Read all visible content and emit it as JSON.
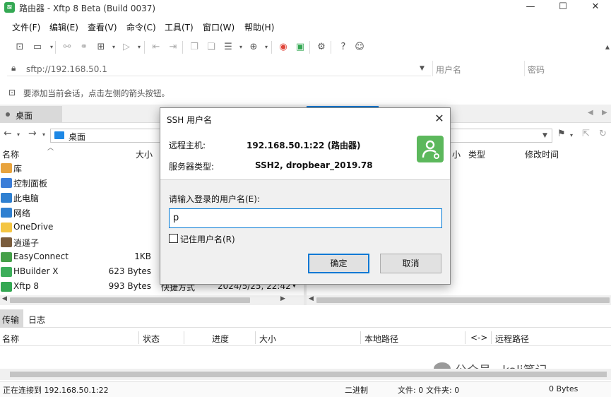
{
  "window": {
    "app_icon_glyph": "≋",
    "title": "路由器 - Xftp 8 Beta (Build 0037)",
    "minimize_glyph": "—",
    "maximize_glyph": "☐",
    "close_glyph": "✕"
  },
  "menu": {
    "items": [
      "文件(F)",
      "编辑(E)",
      "查看(V)",
      "命令(C)",
      "工具(T)",
      "窗口(W)",
      "帮助(H)"
    ]
  },
  "address": {
    "url": "sftp://192.168.50.1",
    "username_placeholder": "用户名",
    "password_placeholder": "密码"
  },
  "hint": {
    "text": "要添加当前会话，点击左侧的箭头按钮。"
  },
  "local_tab": {
    "label": "桌面"
  },
  "local_path": {
    "value": "桌面"
  },
  "local_columns": {
    "name": "名称",
    "size": "大小"
  },
  "remote_columns": {
    "size_partial": "小",
    "type": "类型",
    "modified": "修改时间"
  },
  "local_files": [
    {
      "name": "库",
      "size": "",
      "icon": "library-icon",
      "color": "#e8a33d"
    },
    {
      "name": "控制面板",
      "size": "",
      "icon": "control-panel-icon",
      "color": "#3b7dd8"
    },
    {
      "name": "此电脑",
      "size": "",
      "icon": "computer-icon",
      "color": "#2f80d1"
    },
    {
      "name": "网络",
      "size": "",
      "icon": "network-icon",
      "color": "#2f80d1"
    },
    {
      "name": "OneDrive",
      "size": "",
      "icon": "folder-icon",
      "color": "#f4c542"
    },
    {
      "name": "逍遥子",
      "size": "",
      "icon": "user-icon",
      "color": "#7a5c3c"
    },
    {
      "name": "EasyConnect",
      "size": "1KB",
      "icon": "easyconnect-icon",
      "color": "#45a049"
    },
    {
      "name": "HBuilder X",
      "size": "623 Bytes",
      "icon": "hbuilder-icon",
      "color": "#3cae5a"
    },
    {
      "name": "Xftp 8",
      "size": "993 Bytes",
      "icon": "xftp-icon",
      "color": "#34a853",
      "type": "快捷方式",
      "modified": "2024/5/25, 22:42"
    }
  ],
  "bottom_tabs": {
    "transfer": "传输",
    "log": "日志"
  },
  "transfer_columns": [
    "名称",
    "状态",
    "进度",
    "大小",
    "本地路径",
    "<->",
    "远程路径"
  ],
  "status": {
    "connecting": "正在连接到 192.168.50.1:22",
    "mode": "二进制",
    "files": "文件: 0",
    "folders": "文件夹: 0",
    "bytes": "0 Bytes"
  },
  "watermark": {
    "text": "公众号 · kali笔记"
  },
  "dialog": {
    "title": "SSH 用户名",
    "close_glyph": "✕",
    "remote_host_label": "远程主机:",
    "remote_host_value": "192.168.50.1:22 (路由器)",
    "server_type_label": "服务器类型:",
    "server_type_value": "SSH2, dropbear_2019.78",
    "prompt": "请输入登录的用户名(E):",
    "username_value": "p",
    "remember_label": "记住用户名(R)",
    "ok_label": "确定",
    "cancel_label": "取消"
  }
}
